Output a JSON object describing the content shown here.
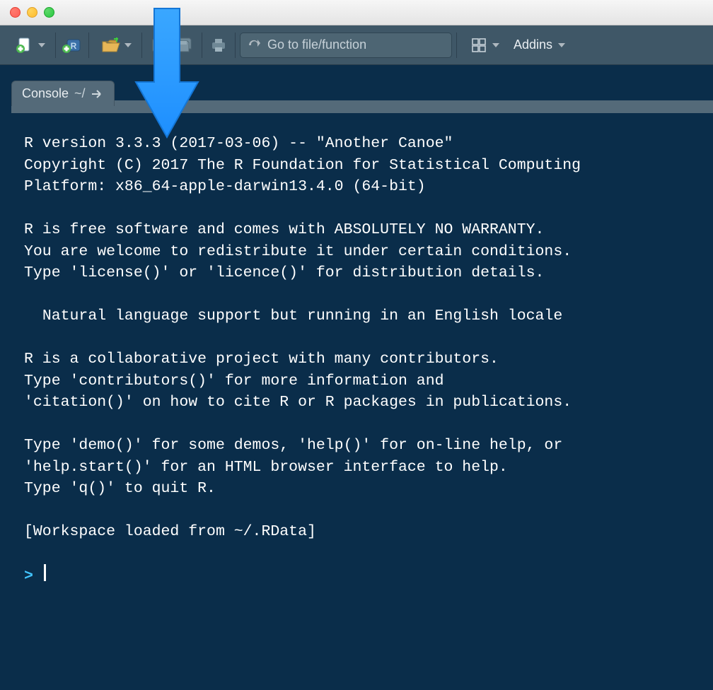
{
  "toolbar": {
    "goto_placeholder": "Go to file/function",
    "addins_label": "Addins"
  },
  "tab": {
    "label": "Console",
    "path": "~/"
  },
  "console": {
    "lines": [
      "R version 3.3.3 (2017-03-06) -- \"Another Canoe\"",
      "Copyright (C) 2017 The R Foundation for Statistical Computing",
      "Platform: x86_64-apple-darwin13.4.0 (64-bit)",
      "",
      "R is free software and comes with ABSOLUTELY NO WARRANTY.",
      "You are welcome to redistribute it under certain conditions.",
      "Type 'license()' or 'licence()' for distribution details.",
      "",
      "  Natural language support but running in an English locale",
      "",
      "R is a collaborative project with many contributors.",
      "Type 'contributors()' for more information and",
      "'citation()' on how to cite R or R packages in publications.",
      "",
      "Type 'demo()' for some demos, 'help()' for on-line help, or",
      "'help.start()' for an HTML browser interface to help.",
      "Type 'q()' to quit R.",
      "",
      "[Workspace loaded from ~/.RData]",
      ""
    ],
    "prompt": ">"
  }
}
